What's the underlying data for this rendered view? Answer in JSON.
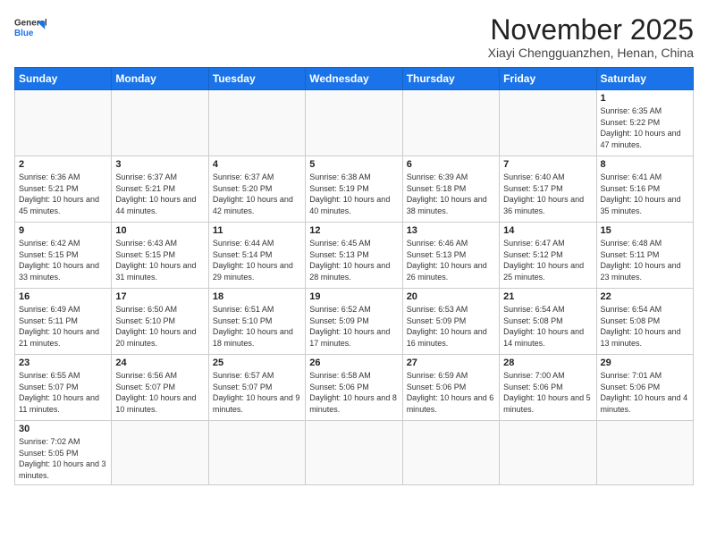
{
  "header": {
    "logo_general": "General",
    "logo_blue": "Blue",
    "month": "November 2025",
    "location": "Xiayi Chengguanzhen, Henan, China"
  },
  "weekdays": [
    "Sunday",
    "Monday",
    "Tuesday",
    "Wednesday",
    "Thursday",
    "Friday",
    "Saturday"
  ],
  "days": [
    {
      "num": "",
      "info": ""
    },
    {
      "num": "",
      "info": ""
    },
    {
      "num": "",
      "info": ""
    },
    {
      "num": "",
      "info": ""
    },
    {
      "num": "",
      "info": ""
    },
    {
      "num": "",
      "info": ""
    },
    {
      "num": "1",
      "info": "Sunrise: 6:35 AM\nSunset: 5:22 PM\nDaylight: 10 hours and 47 minutes."
    },
    {
      "num": "2",
      "info": "Sunrise: 6:36 AM\nSunset: 5:21 PM\nDaylight: 10 hours and 45 minutes."
    },
    {
      "num": "3",
      "info": "Sunrise: 6:37 AM\nSunset: 5:21 PM\nDaylight: 10 hours and 44 minutes."
    },
    {
      "num": "4",
      "info": "Sunrise: 6:37 AM\nSunset: 5:20 PM\nDaylight: 10 hours and 42 minutes."
    },
    {
      "num": "5",
      "info": "Sunrise: 6:38 AM\nSunset: 5:19 PM\nDaylight: 10 hours and 40 minutes."
    },
    {
      "num": "6",
      "info": "Sunrise: 6:39 AM\nSunset: 5:18 PM\nDaylight: 10 hours and 38 minutes."
    },
    {
      "num": "7",
      "info": "Sunrise: 6:40 AM\nSunset: 5:17 PM\nDaylight: 10 hours and 36 minutes."
    },
    {
      "num": "8",
      "info": "Sunrise: 6:41 AM\nSunset: 5:16 PM\nDaylight: 10 hours and 35 minutes."
    },
    {
      "num": "9",
      "info": "Sunrise: 6:42 AM\nSunset: 5:15 PM\nDaylight: 10 hours and 33 minutes."
    },
    {
      "num": "10",
      "info": "Sunrise: 6:43 AM\nSunset: 5:15 PM\nDaylight: 10 hours and 31 minutes."
    },
    {
      "num": "11",
      "info": "Sunrise: 6:44 AM\nSunset: 5:14 PM\nDaylight: 10 hours and 29 minutes."
    },
    {
      "num": "12",
      "info": "Sunrise: 6:45 AM\nSunset: 5:13 PM\nDaylight: 10 hours and 28 minutes."
    },
    {
      "num": "13",
      "info": "Sunrise: 6:46 AM\nSunset: 5:13 PM\nDaylight: 10 hours and 26 minutes."
    },
    {
      "num": "14",
      "info": "Sunrise: 6:47 AM\nSunset: 5:12 PM\nDaylight: 10 hours and 25 minutes."
    },
    {
      "num": "15",
      "info": "Sunrise: 6:48 AM\nSunset: 5:11 PM\nDaylight: 10 hours and 23 minutes."
    },
    {
      "num": "16",
      "info": "Sunrise: 6:49 AM\nSunset: 5:11 PM\nDaylight: 10 hours and 21 minutes."
    },
    {
      "num": "17",
      "info": "Sunrise: 6:50 AM\nSunset: 5:10 PM\nDaylight: 10 hours and 20 minutes."
    },
    {
      "num": "18",
      "info": "Sunrise: 6:51 AM\nSunset: 5:10 PM\nDaylight: 10 hours and 18 minutes."
    },
    {
      "num": "19",
      "info": "Sunrise: 6:52 AM\nSunset: 5:09 PM\nDaylight: 10 hours and 17 minutes."
    },
    {
      "num": "20",
      "info": "Sunrise: 6:53 AM\nSunset: 5:09 PM\nDaylight: 10 hours and 16 minutes."
    },
    {
      "num": "21",
      "info": "Sunrise: 6:54 AM\nSunset: 5:08 PM\nDaylight: 10 hours and 14 minutes."
    },
    {
      "num": "22",
      "info": "Sunrise: 6:54 AM\nSunset: 5:08 PM\nDaylight: 10 hours and 13 minutes."
    },
    {
      "num": "23",
      "info": "Sunrise: 6:55 AM\nSunset: 5:07 PM\nDaylight: 10 hours and 11 minutes."
    },
    {
      "num": "24",
      "info": "Sunrise: 6:56 AM\nSunset: 5:07 PM\nDaylight: 10 hours and 10 minutes."
    },
    {
      "num": "25",
      "info": "Sunrise: 6:57 AM\nSunset: 5:07 PM\nDaylight: 10 hours and 9 minutes."
    },
    {
      "num": "26",
      "info": "Sunrise: 6:58 AM\nSunset: 5:06 PM\nDaylight: 10 hours and 8 minutes."
    },
    {
      "num": "27",
      "info": "Sunrise: 6:59 AM\nSunset: 5:06 PM\nDaylight: 10 hours and 6 minutes."
    },
    {
      "num": "28",
      "info": "Sunrise: 7:00 AM\nSunset: 5:06 PM\nDaylight: 10 hours and 5 minutes."
    },
    {
      "num": "29",
      "info": "Sunrise: 7:01 AM\nSunset: 5:06 PM\nDaylight: 10 hours and 4 minutes."
    },
    {
      "num": "30",
      "info": "Sunrise: 7:02 AM\nSunset: 5:05 PM\nDaylight: 10 hours and 3 minutes."
    },
    {
      "num": "",
      "info": ""
    },
    {
      "num": "",
      "info": ""
    },
    {
      "num": "",
      "info": ""
    },
    {
      "num": "",
      "info": ""
    },
    {
      "num": "",
      "info": ""
    },
    {
      "num": "",
      "info": ""
    }
  ]
}
